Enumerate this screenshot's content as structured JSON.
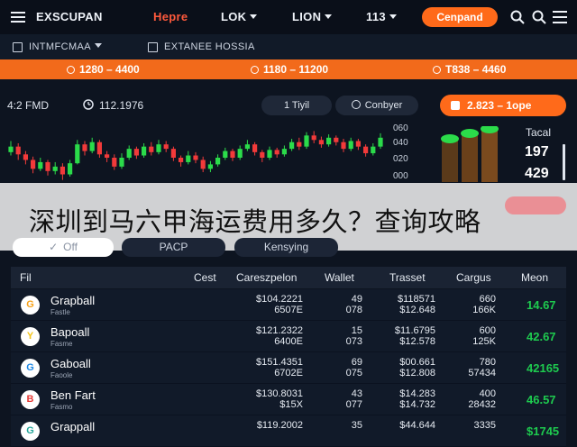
{
  "nav": {
    "brand": "EXSCUPAN",
    "items": [
      "Hepre",
      "LOK",
      "LION",
      "113"
    ],
    "cta": "Cenpand"
  },
  "subbar": {
    "left": "INTMFCMAA",
    "right": "EXTANEE HOSSIA"
  },
  "ticker": [
    "1280 – 4400",
    "1180 – 11200",
    "T838 – 4460"
  ],
  "meta": {
    "left": "4:2 FMD",
    "time": "112.1976",
    "pill1": "1 Tiyil",
    "pill2": "Conbyer",
    "orange": "2.823 – 1ope"
  },
  "chart_data": {
    "type": "candlestick",
    "y_ticks": [
      "060",
      "040",
      "020",
      "000"
    ],
    "candles": [
      {
        "o": 35,
        "c": 40,
        "h": 45,
        "l": 32
      },
      {
        "o": 40,
        "c": 33,
        "h": 43,
        "l": 28
      },
      {
        "o": 33,
        "c": 28,
        "h": 36,
        "l": 24
      },
      {
        "o": 28,
        "c": 20,
        "h": 31,
        "l": 16
      },
      {
        "o": 20,
        "c": 26,
        "h": 30,
        "l": 18
      },
      {
        "o": 26,
        "c": 18,
        "h": 28,
        "l": 14
      },
      {
        "o": 18,
        "c": 22,
        "h": 26,
        "l": 15
      },
      {
        "o": 22,
        "c": 15,
        "h": 25,
        "l": 10
      },
      {
        "o": 15,
        "c": 25,
        "h": 28,
        "l": 13
      },
      {
        "o": 25,
        "c": 42,
        "h": 46,
        "l": 24
      },
      {
        "o": 42,
        "c": 36,
        "h": 45,
        "l": 32
      },
      {
        "o": 36,
        "c": 44,
        "h": 48,
        "l": 34
      },
      {
        "o": 44,
        "c": 33,
        "h": 46,
        "l": 30
      },
      {
        "o": 33,
        "c": 30,
        "h": 36,
        "l": 26
      },
      {
        "o": 30,
        "c": 22,
        "h": 33,
        "l": 19
      },
      {
        "o": 22,
        "c": 30,
        "h": 34,
        "l": 20
      },
      {
        "o": 30,
        "c": 38,
        "h": 41,
        "l": 28
      },
      {
        "o": 38,
        "c": 32,
        "h": 40,
        "l": 29
      },
      {
        "o": 32,
        "c": 40,
        "h": 43,
        "l": 30
      },
      {
        "o": 40,
        "c": 35,
        "h": 44,
        "l": 32
      },
      {
        "o": 35,
        "c": 42,
        "h": 46,
        "l": 33
      },
      {
        "o": 42,
        "c": 38,
        "h": 45,
        "l": 35
      },
      {
        "o": 38,
        "c": 30,
        "h": 40,
        "l": 27
      },
      {
        "o": 30,
        "c": 26,
        "h": 32,
        "l": 22
      },
      {
        "o": 26,
        "c": 32,
        "h": 36,
        "l": 24
      },
      {
        "o": 32,
        "c": 28,
        "h": 35,
        "l": 25
      },
      {
        "o": 28,
        "c": 20,
        "h": 31,
        "l": 17
      },
      {
        "o": 20,
        "c": 24,
        "h": 27,
        "l": 17
      },
      {
        "o": 24,
        "c": 30,
        "h": 33,
        "l": 22
      },
      {
        "o": 30,
        "c": 36,
        "h": 39,
        "l": 28
      },
      {
        "o": 36,
        "c": 30,
        "h": 38,
        "l": 27
      },
      {
        "o": 30,
        "c": 38,
        "h": 41,
        "l": 28
      },
      {
        "o": 38,
        "c": 42,
        "h": 46,
        "l": 36
      },
      {
        "o": 42,
        "c": 35,
        "h": 44,
        "l": 32
      },
      {
        "o": 35,
        "c": 30,
        "h": 37,
        "l": 26
      },
      {
        "o": 30,
        "c": 37,
        "h": 40,
        "l": 28
      },
      {
        "o": 37,
        "c": 33,
        "h": 39,
        "l": 30
      },
      {
        "o": 33,
        "c": 38,
        "h": 41,
        "l": 31
      },
      {
        "o": 38,
        "c": 44,
        "h": 47,
        "l": 36
      },
      {
        "o": 44,
        "c": 40,
        "h": 48,
        "l": 37
      },
      {
        "o": 40,
        "c": 50,
        "h": 53,
        "l": 38
      },
      {
        "o": 50,
        "c": 46,
        "h": 54,
        "l": 43
      },
      {
        "o": 46,
        "c": 42,
        "h": 49,
        "l": 39
      },
      {
        "o": 42,
        "c": 48,
        "h": 51,
        "l": 40
      },
      {
        "o": 48,
        "c": 44,
        "h": 50,
        "l": 41
      },
      {
        "o": 44,
        "c": 38,
        "h": 47,
        "l": 35
      },
      {
        "o": 38,
        "c": 45,
        "h": 48,
        "l": 36
      },
      {
        "o": 45,
        "c": 40,
        "h": 47,
        "l": 37
      },
      {
        "o": 40,
        "c": 34,
        "h": 42,
        "l": 31
      },
      {
        "o": 34,
        "c": 40,
        "h": 43,
        "l": 32
      },
      {
        "o": 40,
        "c": 48,
        "h": 52,
        "l": 38
      }
    ]
  },
  "stats": {
    "label": "Tacal",
    "val1": "197",
    "val2": "429"
  },
  "overlay": {
    "title": "深圳到马六甲海运费用多久？查询攻略"
  },
  "segments": [
    "Off",
    "PACP",
    "Kensying"
  ],
  "table": {
    "headers": [
      "Fil",
      "Cest",
      "Careszpelon",
      "Wallet",
      "Trasset",
      "Cargus",
      "Meon"
    ],
    "rows": [
      {
        "name": "Grapball",
        "sub": "Fastle",
        "logo": "G",
        "c1": "$104.2221",
        "c1b": "6507E",
        "c2": "49",
        "c2b": "078",
        "c3": "$118571",
        "c3b": "$12.648",
        "c4": "660",
        "c4b": "166K",
        "g": "14.67"
      },
      {
        "name": "Bapoall",
        "sub": "Fasme",
        "logo": "Y",
        "c1": "$121.2322",
        "c1b": "6400E",
        "c2": "15",
        "c2b": "073",
        "c3": "$11.6795",
        "c3b": "$12.578",
        "c4": "600",
        "c4b": "125K",
        "g": "42.67"
      },
      {
        "name": "Gaboall",
        "sub": "Faoole",
        "logo": "G",
        "c1": "$151.4351",
        "c1b": "6702E",
        "c2": "69",
        "c2b": "075",
        "c3": "$00.661",
        "c3b": "$12.808",
        "c4": "780",
        "c4b": "57434",
        "g": "42165"
      },
      {
        "name": "Ben Fart",
        "sub": "Fasmo",
        "logo": "B",
        "c1": "$130.8031",
        "c1b": "$15X",
        "c2": "43",
        "c2b": "077",
        "c3": "$14.283",
        "c3b": "$14.732",
        "c4": "400",
        "c4b": "28432",
        "g": "46.57"
      },
      {
        "name": "Grappall",
        "sub": "",
        "logo": "G",
        "c1": "$119.2002",
        "c1b": "",
        "c2": "35",
        "c2b": "",
        "c3": "$44.644",
        "c3b": "",
        "c4": "3335",
        "c4b": "",
        "g": "$1745"
      }
    ]
  }
}
